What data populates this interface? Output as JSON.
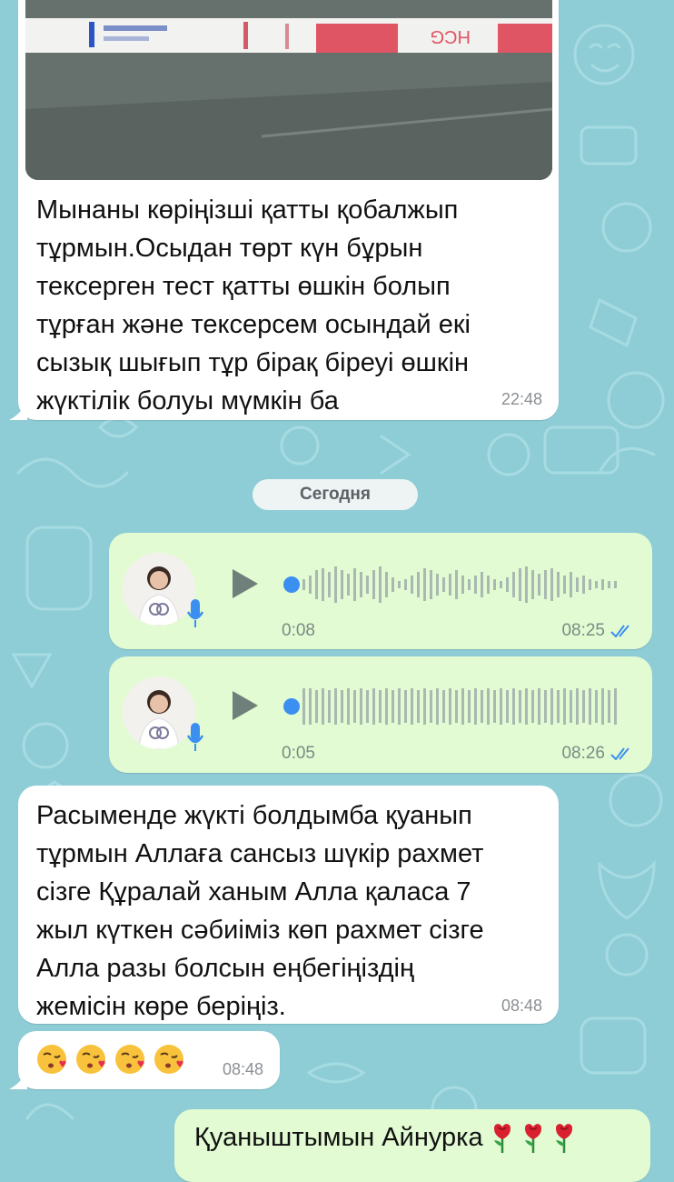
{
  "chat": {
    "test_message": {
      "text": "Мынаны көріңізші қатты қобалжып\nтұрмын.Осыдан төрт күн бұрын\nтексерген тест қатты өшкін болып\nтұрған және тексерсем осындай екі\nсызық шығып тұр бірақ біреуі өшкін\nжүктілік болуы мүмкін ба",
      "time": "22:48",
      "photo_label": "HCG"
    },
    "date_separator": "Сегодня",
    "voice_messages": [
      {
        "duration": "0:08",
        "time": "08:25",
        "status": "read-ticks-icon"
      },
      {
        "duration": "0:05",
        "time": "08:26",
        "status": "read-ticks-icon"
      }
    ],
    "reply_message": {
      "text": "Расыменде жүкті болдымба қуанып\nтұрмын Аллаға сансыз шүкір рахмет\nсізге Құралай ханым Алла қаласа 7\nжыл күткен сәбиіміз көп рахмет сізге\nАлла разы болсын еңбегіңіздің\nжемісін көре беріңіз.",
      "time": "08:48"
    },
    "emoji_message": {
      "emojis": [
        "kiss-emoji-icon",
        "kiss-emoji-icon",
        "kiss-emoji-icon",
        "kiss-emoji-icon"
      ],
      "time": "08:48"
    },
    "outgoing_reply": {
      "text": "Қуаныштымын Айнурка",
      "emojis": [
        "rose-icon",
        "rose-icon",
        "rose-icon"
      ]
    }
  },
  "colors": {
    "wallpaper": "#8ecdd6",
    "incoming_bubble": "#ffffff",
    "outgoing_bubble": "#e2fbd3",
    "voice_progress_dot": "#3b8ff0",
    "read_ticks": "#3b8ff0"
  }
}
